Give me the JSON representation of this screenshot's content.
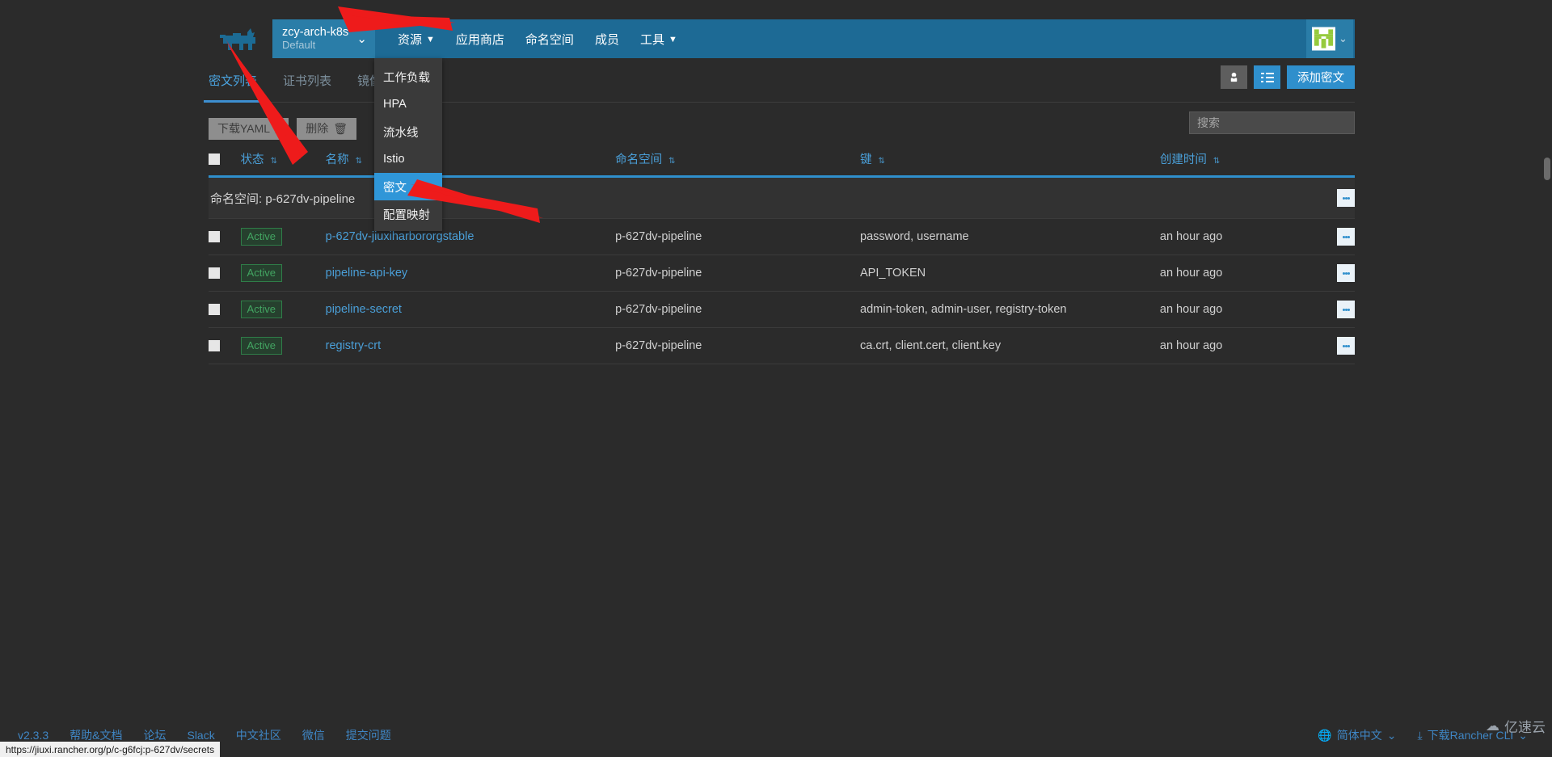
{
  "colors": {
    "header_blue": "#1d6a95",
    "accent_blue": "#2f8fcc",
    "link_blue": "#4a9fd8",
    "page_bg": "#2b2b2b",
    "panel_bg": "#323232",
    "active_green": "#43a562",
    "arrow_red": "#ee1b1b"
  },
  "header": {
    "logo_icon": "rancher-cow-logo",
    "cluster": {
      "name": "zcy-arch-k8s",
      "subtitle": "Default",
      "chevron": "chevron-down-icon"
    },
    "nav": [
      {
        "label": "资源",
        "has_chevron": true
      },
      {
        "label": "应用商店",
        "has_chevron": false
      },
      {
        "label": "命名空间",
        "has_chevron": false
      },
      {
        "label": "成员",
        "has_chevron": false
      },
      {
        "label": "工具",
        "has_chevron": true
      }
    ],
    "avatar": {
      "icon": "user-avatar-identicon",
      "chevron": "chevron-down-icon"
    }
  },
  "resource_dropdown": {
    "items": [
      {
        "label": "工作负载",
        "selected": false
      },
      {
        "label": "HPA",
        "selected": false
      },
      {
        "label": "流水线",
        "selected": false
      },
      {
        "label": "Istio",
        "selected": false
      },
      {
        "label": "密文",
        "selected": true
      },
      {
        "label": "配置映射",
        "selected": false
      }
    ]
  },
  "tabs": [
    {
      "label": "密文列表",
      "active": true
    },
    {
      "label": "证书列表",
      "active": false
    },
    {
      "label": "镜像库凭证",
      "active": false
    }
  ],
  "toolbar": {
    "group_icon": "group-by-icon",
    "list_icon": "list-view-icon",
    "add_label": "添加密文"
  },
  "actions": {
    "download_label": "下载YAML",
    "download_icon": "download-icon",
    "delete_label": "删除",
    "delete_icon": "trash-icon"
  },
  "search": {
    "placeholder": "搜索",
    "value": ""
  },
  "table": {
    "columns": [
      {
        "label": "状态",
        "sortable": true
      },
      {
        "label": "名称",
        "sortable": true
      },
      {
        "label": "命名空间",
        "sortable": true
      },
      {
        "label": "键",
        "sortable": true
      },
      {
        "label": "创建时间",
        "sortable": true
      }
    ],
    "group": {
      "prefix": "命名空间:",
      "value": "p-627dv-pipeline"
    },
    "rows": [
      {
        "state": "Active",
        "name": "p-627dv-jiuxiharbororgstable",
        "namespace": "p-627dv-pipeline",
        "keys": "password, username",
        "created": "an hour ago"
      },
      {
        "state": "Active",
        "name": "pipeline-api-key",
        "namespace": "p-627dv-pipeline",
        "keys": "API_TOKEN",
        "created": "an hour ago"
      },
      {
        "state": "Active",
        "name": "pipeline-secret",
        "namespace": "p-627dv-pipeline",
        "keys": "admin-token, admin-user, registry-token",
        "created": "an hour ago"
      },
      {
        "state": "Active",
        "name": "registry-crt",
        "namespace": "p-627dv-pipeline",
        "keys": "ca.crt, client.cert, client.key",
        "created": "an hour ago"
      }
    ]
  },
  "footer": {
    "left": [
      {
        "label": "v2.3.3"
      },
      {
        "label": "帮助&文档"
      },
      {
        "label": "论坛"
      },
      {
        "label": "Slack"
      },
      {
        "label": "中文社区"
      },
      {
        "label": "微信"
      },
      {
        "label": "提交问题"
      }
    ],
    "language": {
      "icon": "globe-icon",
      "label": "简体中文",
      "chevron": "chevron-down-icon"
    },
    "cli": {
      "icon": "download-icon",
      "label": "下载Rancher CLI",
      "chevron": "chevron-down-icon"
    }
  },
  "statusbar": {
    "url": "https://jiuxi.rancher.org/p/c-g6fcj:p-627dv/secrets"
  },
  "watermark": {
    "label": "亿速云",
    "icon": "cloud-logo-icon"
  }
}
